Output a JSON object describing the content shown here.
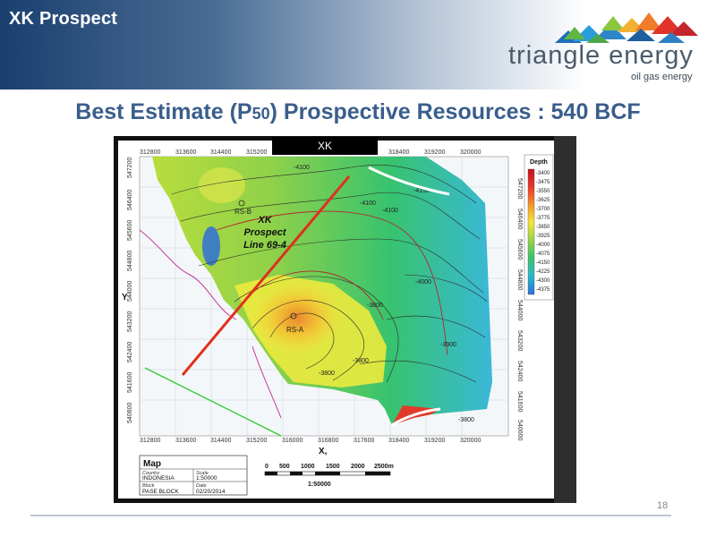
{
  "slide": {
    "corner_title": "XK Prospect",
    "title_pre": "Best Estimate (P",
    "title_sub": "50",
    "title_post": ") Prospective Resources :  540 BCF",
    "page_number": "18"
  },
  "logo": {
    "name": "triangle energy",
    "tagline": "oil gas energy"
  },
  "map": {
    "tag": "XK",
    "x_ticks": [
      "312800",
      "313600",
      "314400",
      "315200",
      "316000",
      "316800",
      "317600",
      "318400",
      "319200",
      "320000"
    ],
    "y_ticks": [
      "547200",
      "546400",
      "545600",
      "544800",
      "544000",
      "543200",
      "542400",
      "541600",
      "540800",
      "540000"
    ],
    "x_axis_label": "X,",
    "y_axis_label": "Y",
    "prospect_label_1": "XK",
    "prospect_label_2": "Prospect",
    "prospect_label_3": "Line 69-4",
    "well_label_1": "RS-B",
    "well_label_2": "RS-A",
    "contours": [
      "-4100",
      "-4100",
      "-4150",
      "-4100",
      "-4000",
      "-3800",
      "-3900",
      "-3800",
      "-3800",
      "-3800"
    ],
    "legend": {
      "title": "Depth",
      "values": [
        "-3400",
        "-3475",
        "-3550",
        "-3625",
        "-3700",
        "-3775",
        "-3850",
        "-3925",
        "-4000",
        "-4075",
        "-4150",
        "-4225",
        "-4300",
        "-4375"
      ]
    },
    "info": {
      "heading": "Map",
      "country_label": "Country",
      "country": "INDONESIA",
      "scale_label": "Scale",
      "scale": "1:50000",
      "block_label": "Block",
      "block": "PASE BLOCK",
      "date_label": "Date",
      "date": "02/20/2014"
    },
    "scale_bar": {
      "labels": [
        "0",
        "500",
        "1000",
        "1500",
        "2000",
        "2500m"
      ],
      "ratio": "1:50000"
    }
  }
}
